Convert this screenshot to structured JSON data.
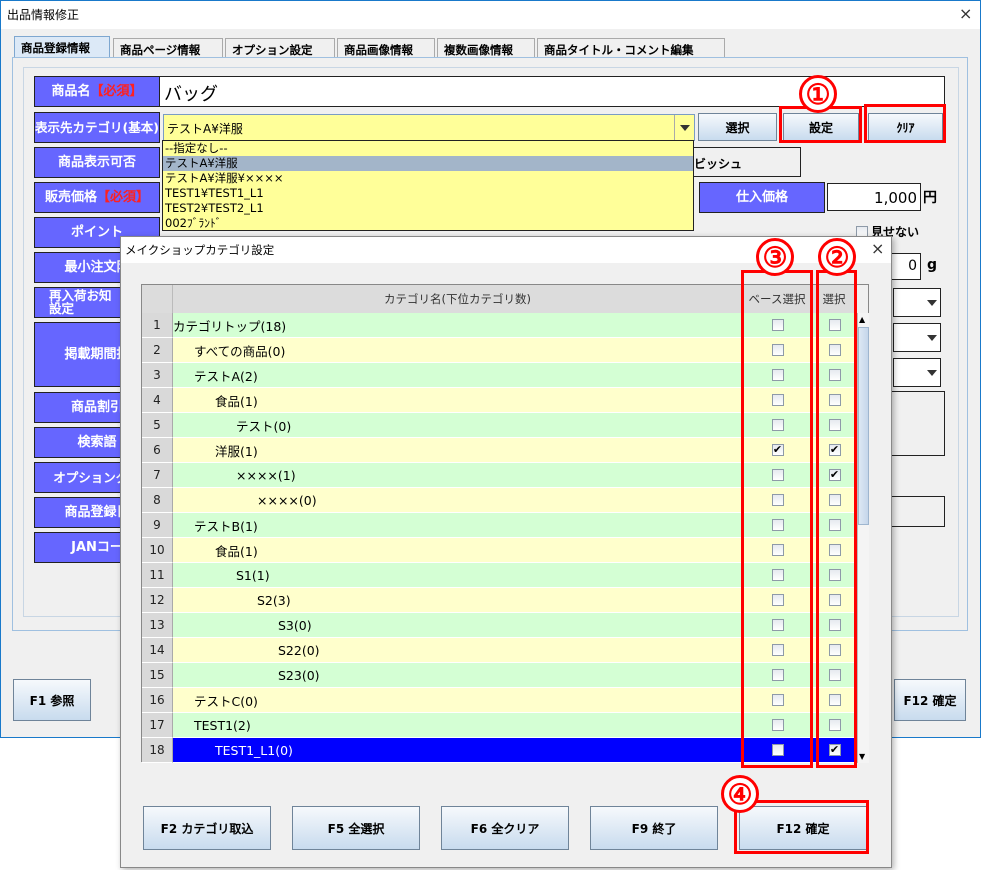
{
  "main": {
    "title": "出品情報修正",
    "close": "×",
    "tabs": [
      "商品登録情報",
      "商品ページ情報",
      "オプション設定",
      "商品画像情報",
      "複数画像情報",
      "商品タイトル・コメント編集"
    ],
    "labels": {
      "name": "商品名",
      "required": "【必須】",
      "category": "表示先カテゴリ(基本)",
      "display": "商品表示可否",
      "price": "販売価格",
      "point": "ポイント",
      "min_order": "最小注文限",
      "restock": "再入荷お知",
      "restock2": "設定",
      "period": "掲載期間指",
      "discount": "商品割引",
      "search": "検索語",
      "option_group": "オプショングル",
      "reg_date": "商品登録日",
      "jan": "JANコー",
      "cost": "仕入価格"
    },
    "name_value": "バッグ",
    "category_value": "テストA¥洋服",
    "category_options": [
      "--指定なし--",
      "テストA¥洋服",
      "テストA¥洋服¥××××",
      "TEST1¥TEST1_L1",
      "TEST2¥TEST2_L1",
      "002ﾌﾞﾗﾝﾄﾞ"
    ],
    "buttons": {
      "select": "選択",
      "set": "設定",
      "clear": "ｸﾘｱ",
      "f1": "F1 参照",
      "f12": "F12 確定"
    },
    "display_value": "ビッシュ",
    "cost_value": "1,000",
    "yen": "円",
    "hide_label": "見せない",
    "weight_value": "0",
    "gram": "g"
  },
  "dialog": {
    "title": "メイクショップカテゴリ設定",
    "close": "×",
    "headers": {
      "name": "カテゴリ名(下位カテゴリ数)",
      "base": "ベース選択",
      "select": "選択"
    },
    "rows": [
      {
        "n": "1",
        "name": "カテゴリトップ(18)",
        "lv": 0,
        "base": false,
        "sel": false
      },
      {
        "n": "2",
        "name": "すべての商品(0)",
        "lv": 1,
        "base": false,
        "sel": false
      },
      {
        "n": "3",
        "name": "テストA(2)",
        "lv": 1,
        "base": false,
        "sel": false
      },
      {
        "n": "4",
        "name": "食品(1)",
        "lv": 2,
        "base": false,
        "sel": false
      },
      {
        "n": "5",
        "name": "テスト(0)",
        "lv": 3,
        "base": false,
        "sel": false
      },
      {
        "n": "6",
        "name": "洋服(1)",
        "lv": 2,
        "base": true,
        "sel": true
      },
      {
        "n": "7",
        "name": "××××(1)",
        "lv": 3,
        "base": false,
        "sel": true
      },
      {
        "n": "8",
        "name": "××××(0)",
        "lv": 4,
        "base": false,
        "sel": false
      },
      {
        "n": "9",
        "name": "テストB(1)",
        "lv": 1,
        "base": false,
        "sel": false
      },
      {
        "n": "10",
        "name": "食品(1)",
        "lv": 2,
        "base": false,
        "sel": false
      },
      {
        "n": "11",
        "name": "S1(1)",
        "lv": 3,
        "base": false,
        "sel": false
      },
      {
        "n": "12",
        "name": "S2(3)",
        "lv": 4,
        "base": false,
        "sel": false
      },
      {
        "n": "13",
        "name": "S3(0)",
        "lv": 5,
        "base": false,
        "sel": false
      },
      {
        "n": "14",
        "name": "S22(0)",
        "lv": 5,
        "base": false,
        "sel": false
      },
      {
        "n": "15",
        "name": "S23(0)",
        "lv": 5,
        "base": false,
        "sel": false
      },
      {
        "n": "16",
        "name": "テストC(0)",
        "lv": 1,
        "base": false,
        "sel": false
      },
      {
        "n": "17",
        "name": "TEST1(2)",
        "lv": 1,
        "base": false,
        "sel": false
      },
      {
        "n": "18",
        "name": "TEST1_L1(0)",
        "lv": 2,
        "base": false,
        "sel": true,
        "selected": true
      }
    ],
    "buttons": [
      "F2 カテゴリ取込",
      "F5 全選択",
      "F6 全クリア",
      "F9 終了",
      "F12 確定"
    ]
  },
  "annotations": [
    "①",
    "②",
    "③",
    "④"
  ],
  "colors": {
    "label_bg": "#6666ff",
    "required": "#ff2020",
    "annotation": "#ff0000",
    "row_green": "#d4ffd4",
    "row_yellow": "#ffffcc",
    "selected_row": "#0000ff"
  }
}
